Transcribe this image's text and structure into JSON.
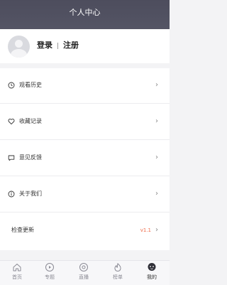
{
  "header": {
    "title": "个人中心"
  },
  "profile": {
    "login_label": "登录",
    "register_label": "注册"
  },
  "menu": {
    "items": [
      {
        "label": "观看历史",
        "icon": "clock-icon"
      },
      {
        "label": "收藏记录",
        "icon": "heart-icon"
      },
      {
        "label": "意见反馈",
        "icon": "message-icon"
      },
      {
        "label": "关于我们",
        "icon": "info-icon"
      }
    ],
    "update": {
      "label": "检查更新",
      "version": "v1.1"
    }
  },
  "tabbar": {
    "tabs": [
      {
        "label": "首页",
        "icon": "home-icon",
        "active": false
      },
      {
        "label": "专题",
        "icon": "topic-icon",
        "active": false
      },
      {
        "label": "直播",
        "icon": "live-icon",
        "active": false
      },
      {
        "label": "榜单",
        "icon": "flame-icon",
        "active": false
      },
      {
        "label": "我的",
        "icon": "profile-icon",
        "active": true
      }
    ]
  },
  "colors": {
    "header": "#4d4d5d",
    "accent": "#ef6b4a"
  }
}
